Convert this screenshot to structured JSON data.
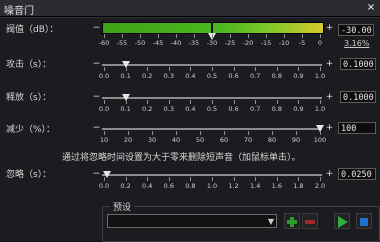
{
  "window": {
    "title": "噪音门",
    "close_glyph": "×"
  },
  "threshold": {
    "label": "阀值（dB）：",
    "ticks": [
      "-60",
      "-55",
      "-50",
      "-45",
      "-40",
      "-35",
      "-30",
      "-25",
      "-20",
      "-15",
      "-10",
      "-5",
      "0"
    ],
    "value": "-30.00",
    "meter_percent": "3.16%",
    "level_fraction": 0.5
  },
  "attack": {
    "label": "攻击（s）：",
    "ticks": [
      "0.0",
      "0.1",
      "0.2",
      "0.3",
      "0.4",
      "0.5",
      "0.6",
      "0.7",
      "0.8",
      "0.9",
      "1.0"
    ],
    "value": "0.1000",
    "level_fraction": 0.1
  },
  "release": {
    "label": "释放（s）：",
    "ticks": [
      "0.0",
      "0.1",
      "0.2",
      "0.3",
      "0.4",
      "0.5",
      "0.6",
      "0.7",
      "0.8",
      "0.9",
      "1.0"
    ],
    "value": "0.1000",
    "level_fraction": 0.1
  },
  "reduction": {
    "label": "减少（%）：",
    "ticks": [
      "10",
      "20",
      "30",
      "40",
      "50",
      "60",
      "70",
      "80",
      "90",
      "100"
    ],
    "value": "100",
    "level_fraction": 1.0
  },
  "hint": "通过将忽略时间设置为大于零来删除短声音（加鼠标单击）。",
  "ignore": {
    "label": "忽略（s）：",
    "ticks": [
      "0.0",
      "0.2",
      "0.4",
      "0.6",
      "0.8",
      "1.0",
      "1.2",
      "1.4",
      "1.6",
      "1.8",
      "2.0"
    ],
    "value": "0.0250",
    "level_fraction": 0.0125
  },
  "preset": {
    "title": "预设",
    "selected": ""
  },
  "buttons": {
    "add_icon": "plus-icon",
    "remove_icon": "minus-icon",
    "play_icon": "play-icon",
    "stop_icon": "stop-icon"
  },
  "colors": {
    "meter_green": "#3ca316",
    "meter_yellow": "#d8c82a",
    "add_green": "#2f9b2f",
    "remove_red": "#a02a2a",
    "play_green": "#2fae3a",
    "stop_blue": "#1f6fd0"
  },
  "pm": {
    "minus": "−",
    "plus": "+"
  }
}
